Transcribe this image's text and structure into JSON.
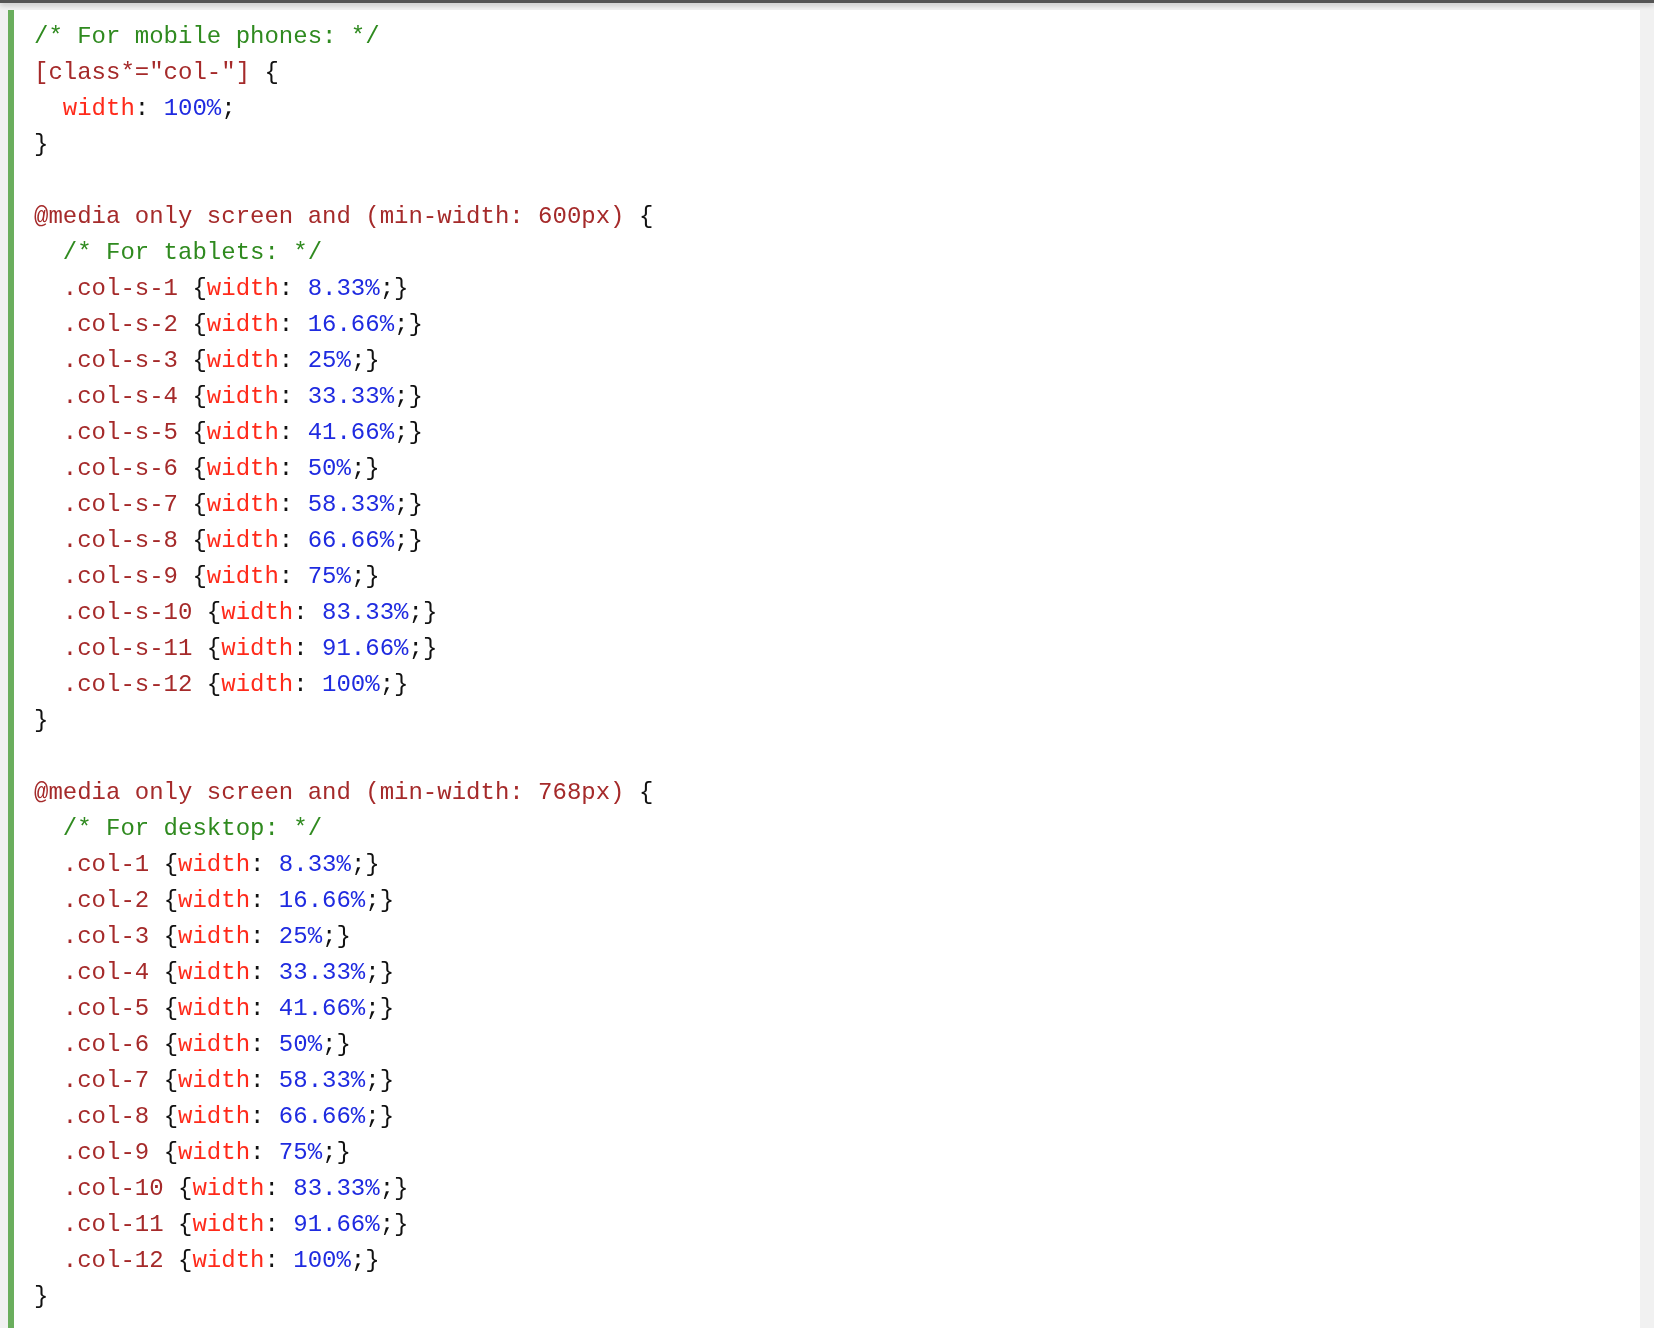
{
  "code": [
    {
      "kind": "line",
      "tokens": [
        {
          "kind": "comment",
          "text": "/* For mobile phones: */"
        }
      ]
    },
    {
      "kind": "line",
      "tokens": [
        {
          "kind": "selector",
          "text": "[class*=\"col-\"] "
        },
        {
          "kind": "punct",
          "text": "{"
        }
      ],
      "children": [
        {
          "kind": "line",
          "tokens": [
            {
              "kind": "property",
              "text": "width"
            },
            {
              "kind": "punct",
              "text": ": "
            },
            {
              "kind": "value",
              "text": "100%"
            },
            {
              "kind": "punct",
              "text": ";"
            }
          ]
        }
      ]
    },
    {
      "kind": "line",
      "tokens": [
        {
          "kind": "punct",
          "text": "}"
        }
      ]
    },
    {
      "kind": "blank"
    },
    {
      "kind": "line",
      "tokens": [
        {
          "kind": "selector",
          "text": "@media only screen and (min-width: 600px) "
        },
        {
          "kind": "punct",
          "text": "{"
        }
      ],
      "children": [
        {
          "kind": "line",
          "tokens": [
            {
              "kind": "comment",
              "text": "/* For tablets: */"
            }
          ]
        },
        {
          "kind": "line",
          "tokens": [
            {
              "kind": "selector",
              "text": ".col-s-1 "
            },
            {
              "kind": "punct",
              "text": "{"
            },
            {
              "kind": "property",
              "text": "width"
            },
            {
              "kind": "punct",
              "text": ": "
            },
            {
              "kind": "value",
              "text": "8.33%"
            },
            {
              "kind": "punct",
              "text": ";}"
            }
          ]
        },
        {
          "kind": "line",
          "tokens": [
            {
              "kind": "selector",
              "text": ".col-s-2 "
            },
            {
              "kind": "punct",
              "text": "{"
            },
            {
              "kind": "property",
              "text": "width"
            },
            {
              "kind": "punct",
              "text": ": "
            },
            {
              "kind": "value",
              "text": "16.66%"
            },
            {
              "kind": "punct",
              "text": ";}"
            }
          ]
        },
        {
          "kind": "line",
          "tokens": [
            {
              "kind": "selector",
              "text": ".col-s-3 "
            },
            {
              "kind": "punct",
              "text": "{"
            },
            {
              "kind": "property",
              "text": "width"
            },
            {
              "kind": "punct",
              "text": ": "
            },
            {
              "kind": "value",
              "text": "25%"
            },
            {
              "kind": "punct",
              "text": ";}"
            }
          ]
        },
        {
          "kind": "line",
          "tokens": [
            {
              "kind": "selector",
              "text": ".col-s-4 "
            },
            {
              "kind": "punct",
              "text": "{"
            },
            {
              "kind": "property",
              "text": "width"
            },
            {
              "kind": "punct",
              "text": ": "
            },
            {
              "kind": "value",
              "text": "33.33%"
            },
            {
              "kind": "punct",
              "text": ";}"
            }
          ]
        },
        {
          "kind": "line",
          "tokens": [
            {
              "kind": "selector",
              "text": ".col-s-5 "
            },
            {
              "kind": "punct",
              "text": "{"
            },
            {
              "kind": "property",
              "text": "width"
            },
            {
              "kind": "punct",
              "text": ": "
            },
            {
              "kind": "value",
              "text": "41.66%"
            },
            {
              "kind": "punct",
              "text": ";}"
            }
          ]
        },
        {
          "kind": "line",
          "tokens": [
            {
              "kind": "selector",
              "text": ".col-s-6 "
            },
            {
              "kind": "punct",
              "text": "{"
            },
            {
              "kind": "property",
              "text": "width"
            },
            {
              "kind": "punct",
              "text": ": "
            },
            {
              "kind": "value",
              "text": "50%"
            },
            {
              "kind": "punct",
              "text": ";}"
            }
          ]
        },
        {
          "kind": "line",
          "tokens": [
            {
              "kind": "selector",
              "text": ".col-s-7 "
            },
            {
              "kind": "punct",
              "text": "{"
            },
            {
              "kind": "property",
              "text": "width"
            },
            {
              "kind": "punct",
              "text": ": "
            },
            {
              "kind": "value",
              "text": "58.33%"
            },
            {
              "kind": "punct",
              "text": ";}"
            }
          ]
        },
        {
          "kind": "line",
          "tokens": [
            {
              "kind": "selector",
              "text": ".col-s-8 "
            },
            {
              "kind": "punct",
              "text": "{"
            },
            {
              "kind": "property",
              "text": "width"
            },
            {
              "kind": "punct",
              "text": ": "
            },
            {
              "kind": "value",
              "text": "66.66%"
            },
            {
              "kind": "punct",
              "text": ";}"
            }
          ]
        },
        {
          "kind": "line",
          "tokens": [
            {
              "kind": "selector",
              "text": ".col-s-9 "
            },
            {
              "kind": "punct",
              "text": "{"
            },
            {
              "kind": "property",
              "text": "width"
            },
            {
              "kind": "punct",
              "text": ": "
            },
            {
              "kind": "value",
              "text": "75%"
            },
            {
              "kind": "punct",
              "text": ";}"
            }
          ]
        },
        {
          "kind": "line",
          "tokens": [
            {
              "kind": "selector",
              "text": ".col-s-10 "
            },
            {
              "kind": "punct",
              "text": "{"
            },
            {
              "kind": "property",
              "text": "width"
            },
            {
              "kind": "punct",
              "text": ": "
            },
            {
              "kind": "value",
              "text": "83.33%"
            },
            {
              "kind": "punct",
              "text": ";}"
            }
          ]
        },
        {
          "kind": "line",
          "tokens": [
            {
              "kind": "selector",
              "text": ".col-s-11 "
            },
            {
              "kind": "punct",
              "text": "{"
            },
            {
              "kind": "property",
              "text": "width"
            },
            {
              "kind": "punct",
              "text": ": "
            },
            {
              "kind": "value",
              "text": "91.66%"
            },
            {
              "kind": "punct",
              "text": ";}"
            }
          ]
        },
        {
          "kind": "line",
          "tokens": [
            {
              "kind": "selector",
              "text": ".col-s-12 "
            },
            {
              "kind": "punct",
              "text": "{"
            },
            {
              "kind": "property",
              "text": "width"
            },
            {
              "kind": "punct",
              "text": ": "
            },
            {
              "kind": "value",
              "text": "100%"
            },
            {
              "kind": "punct",
              "text": ";}"
            }
          ]
        }
      ]
    },
    {
      "kind": "line",
      "tokens": [
        {
          "kind": "punct",
          "text": "}"
        }
      ]
    },
    {
      "kind": "blank"
    },
    {
      "kind": "line",
      "tokens": [
        {
          "kind": "selector",
          "text": "@media only screen and (min-width: 768px) "
        },
        {
          "kind": "punct",
          "text": "{"
        }
      ],
      "children": [
        {
          "kind": "line",
          "tokens": [
            {
              "kind": "comment",
              "text": "/* For desktop: */"
            }
          ]
        },
        {
          "kind": "line",
          "tokens": [
            {
              "kind": "selector",
              "text": ".col-1 "
            },
            {
              "kind": "punct",
              "text": "{"
            },
            {
              "kind": "property",
              "text": "width"
            },
            {
              "kind": "punct",
              "text": ": "
            },
            {
              "kind": "value",
              "text": "8.33%"
            },
            {
              "kind": "punct",
              "text": ";}"
            }
          ]
        },
        {
          "kind": "line",
          "tokens": [
            {
              "kind": "selector",
              "text": ".col-2 "
            },
            {
              "kind": "punct",
              "text": "{"
            },
            {
              "kind": "property",
              "text": "width"
            },
            {
              "kind": "punct",
              "text": ": "
            },
            {
              "kind": "value",
              "text": "16.66%"
            },
            {
              "kind": "punct",
              "text": ";}"
            }
          ]
        },
        {
          "kind": "line",
          "tokens": [
            {
              "kind": "selector",
              "text": ".col-3 "
            },
            {
              "kind": "punct",
              "text": "{"
            },
            {
              "kind": "property",
              "text": "width"
            },
            {
              "kind": "punct",
              "text": ": "
            },
            {
              "kind": "value",
              "text": "25%"
            },
            {
              "kind": "punct",
              "text": ";}"
            }
          ]
        },
        {
          "kind": "line",
          "tokens": [
            {
              "kind": "selector",
              "text": ".col-4 "
            },
            {
              "kind": "punct",
              "text": "{"
            },
            {
              "kind": "property",
              "text": "width"
            },
            {
              "kind": "punct",
              "text": ": "
            },
            {
              "kind": "value",
              "text": "33.33%"
            },
            {
              "kind": "punct",
              "text": ";}"
            }
          ]
        },
        {
          "kind": "line",
          "tokens": [
            {
              "kind": "selector",
              "text": ".col-5 "
            },
            {
              "kind": "punct",
              "text": "{"
            },
            {
              "kind": "property",
              "text": "width"
            },
            {
              "kind": "punct",
              "text": ": "
            },
            {
              "kind": "value",
              "text": "41.66%"
            },
            {
              "kind": "punct",
              "text": ";}"
            }
          ]
        },
        {
          "kind": "line",
          "tokens": [
            {
              "kind": "selector",
              "text": ".col-6 "
            },
            {
              "kind": "punct",
              "text": "{"
            },
            {
              "kind": "property",
              "text": "width"
            },
            {
              "kind": "punct",
              "text": ": "
            },
            {
              "kind": "value",
              "text": "50%"
            },
            {
              "kind": "punct",
              "text": ";}"
            }
          ]
        },
        {
          "kind": "line",
          "tokens": [
            {
              "kind": "selector",
              "text": ".col-7 "
            },
            {
              "kind": "punct",
              "text": "{"
            },
            {
              "kind": "property",
              "text": "width"
            },
            {
              "kind": "punct",
              "text": ": "
            },
            {
              "kind": "value",
              "text": "58.33%"
            },
            {
              "kind": "punct",
              "text": ";}"
            }
          ]
        },
        {
          "kind": "line",
          "tokens": [
            {
              "kind": "selector",
              "text": ".col-8 "
            },
            {
              "kind": "punct",
              "text": "{"
            },
            {
              "kind": "property",
              "text": "width"
            },
            {
              "kind": "punct",
              "text": ": "
            },
            {
              "kind": "value",
              "text": "66.66%"
            },
            {
              "kind": "punct",
              "text": ";}"
            }
          ]
        },
        {
          "kind": "line",
          "tokens": [
            {
              "kind": "selector",
              "text": ".col-9 "
            },
            {
              "kind": "punct",
              "text": "{"
            },
            {
              "kind": "property",
              "text": "width"
            },
            {
              "kind": "punct",
              "text": ": "
            },
            {
              "kind": "value",
              "text": "75%"
            },
            {
              "kind": "punct",
              "text": ";}"
            }
          ]
        },
        {
          "kind": "line",
          "tokens": [
            {
              "kind": "selector",
              "text": ".col-10 "
            },
            {
              "kind": "punct",
              "text": "{"
            },
            {
              "kind": "property",
              "text": "width"
            },
            {
              "kind": "punct",
              "text": ": "
            },
            {
              "kind": "value",
              "text": "83.33%"
            },
            {
              "kind": "punct",
              "text": ";}"
            }
          ]
        },
        {
          "kind": "line",
          "tokens": [
            {
              "kind": "selector",
              "text": ".col-11 "
            },
            {
              "kind": "punct",
              "text": "{"
            },
            {
              "kind": "property",
              "text": "width"
            },
            {
              "kind": "punct",
              "text": ": "
            },
            {
              "kind": "value",
              "text": "91.66%"
            },
            {
              "kind": "punct",
              "text": ";}"
            }
          ]
        },
        {
          "kind": "line",
          "tokens": [
            {
              "kind": "selector",
              "text": ".col-12 "
            },
            {
              "kind": "punct",
              "text": "{"
            },
            {
              "kind": "property",
              "text": "width"
            },
            {
              "kind": "punct",
              "text": ": "
            },
            {
              "kind": "value",
              "text": "100%"
            },
            {
              "kind": "punct",
              "text": ";}"
            }
          ]
        }
      ]
    },
    {
      "kind": "line",
      "tokens": [
        {
          "kind": "punct",
          "text": "}"
        }
      ]
    }
  ]
}
